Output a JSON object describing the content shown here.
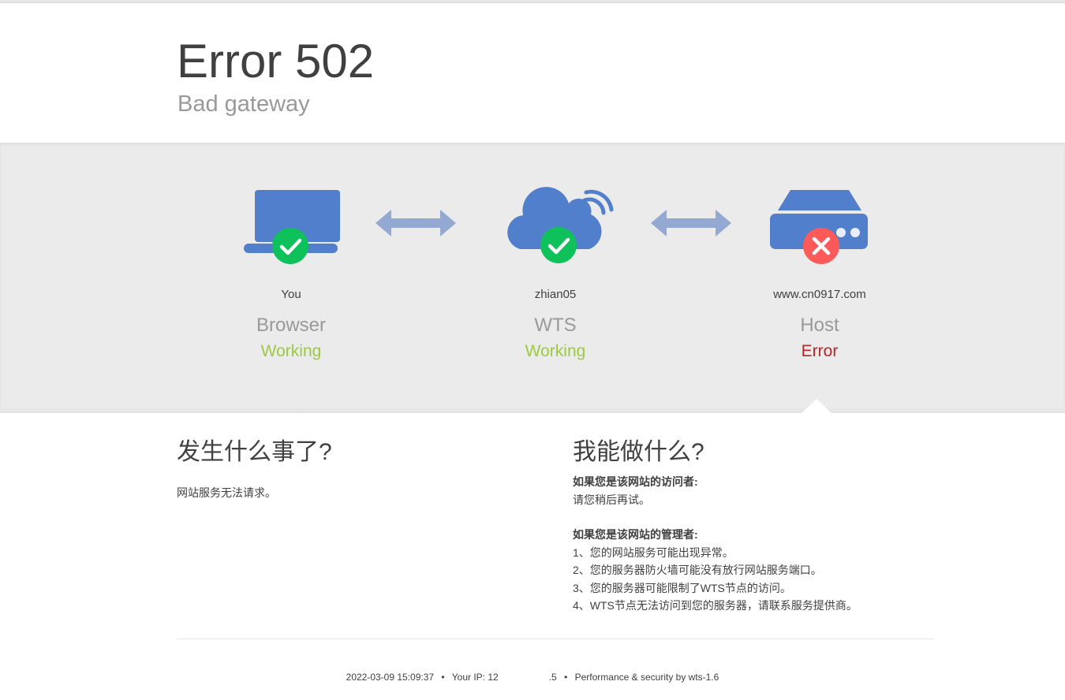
{
  "header": {
    "title": "Error 502",
    "subtitle": "Bad gateway"
  },
  "nodes": [
    {
      "host": "You",
      "role": "Browser",
      "status": "Working",
      "status_type": "ok",
      "icon": "laptop-icon"
    },
    {
      "host": "zhian05",
      "role": "WTS",
      "status": "Working",
      "status_type": "ok",
      "icon": "cloud-icon"
    },
    {
      "host": "www.cn0917.com",
      "role": "Host",
      "status": "Error",
      "status_type": "error",
      "icon": "server-icon"
    }
  ],
  "what_happened": {
    "title": "发生什么事了?",
    "body": "网站服务无法请求。"
  },
  "what_can_i_do": {
    "title": "我能做什么?",
    "visitor_heading": "如果您是该网站的访问者:",
    "visitor_text": "请您稍后再试。",
    "admin_heading": "如果您是该网站的管理者:",
    "admin_items": [
      "1、您的网站服务可能出现异常。",
      "2、您的服务器防火墙可能没有放行网站服务端口。",
      "3、您的服务器可能限制了WTS节点的访问。",
      "4、WTS节点无法访问到您的服务器，请联系服务提供商。"
    ]
  },
  "footer": {
    "timestamp": "2022-03-09 15:09:37",
    "ip_label": "Your IP:",
    "ip_visible_start": "12",
    "ip_visible_end": ".5",
    "powered_by": "Performance & security by wts-1.6",
    "separator": "•"
  },
  "colors": {
    "icon_blue": "#527fcc",
    "arrow_blue": "#94a9d1",
    "ok_green": "#0fc15a",
    "status_ok": "#9bca3e",
    "status_error": "#bd2426",
    "error_red": "#ff5a5a"
  }
}
